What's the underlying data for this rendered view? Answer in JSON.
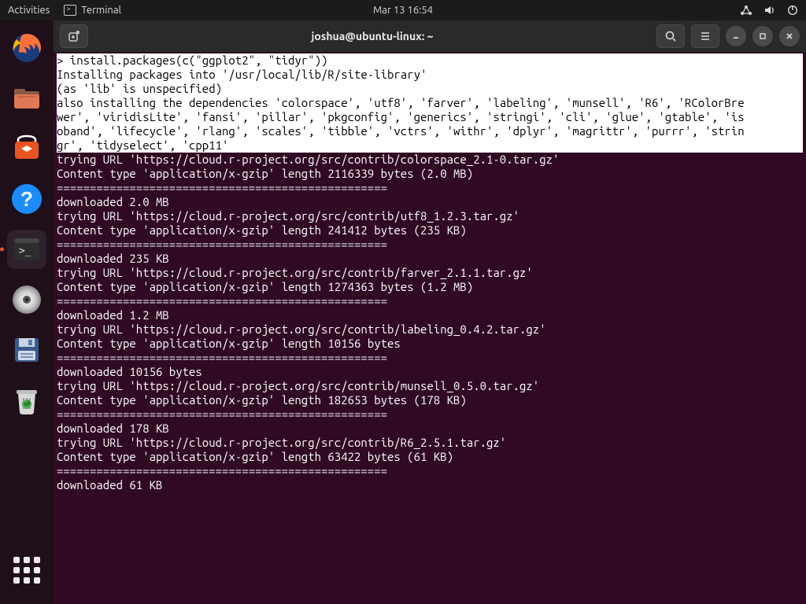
{
  "top_panel": {
    "activities": "Activities",
    "app_label": "Terminal",
    "clock": "Mar 13  16:54"
  },
  "window": {
    "title": "joshua@ubuntu-linux: ~"
  },
  "terminal": {
    "hl_lines": [
      "> install.packages(c(\"ggplot2\", \"tidyr\"))",
      "Installing packages into '/usr/local/lib/R/site-library'",
      "(as 'lib' is unspecified)",
      "also installing the dependencies 'colorspace', 'utf8', 'farver', 'labeling', 'munsell', 'R6', 'RColorBre",
      "wer', 'viridisLite', 'fansi', 'pillar', 'pkgconfig', 'generics', 'stringi', 'cli', 'glue', 'gtable', 'is",
      "oband', 'lifecycle', 'rlang', 'scales', 'tibble', 'vctrs', 'withr', 'dplyr', 'magrittr', 'purrr', 'strin",
      "gr', 'tidyselect', 'cpp11'"
    ],
    "body_lines": [
      "",
      "trying URL 'https://cloud.r-project.org/src/contrib/colorspace_2.1-0.tar.gz'",
      "Content type 'application/x-gzip' length 2116339 bytes (2.0 MB)",
      "==================================================",
      "downloaded 2.0 MB",
      "",
      "trying URL 'https://cloud.r-project.org/src/contrib/utf8_1.2.3.tar.gz'",
      "Content type 'application/x-gzip' length 241412 bytes (235 KB)",
      "==================================================",
      "downloaded 235 KB",
      "",
      "trying URL 'https://cloud.r-project.org/src/contrib/farver_2.1.1.tar.gz'",
      "Content type 'application/x-gzip' length 1274363 bytes (1.2 MB)",
      "==================================================",
      "downloaded 1.2 MB",
      "",
      "trying URL 'https://cloud.r-project.org/src/contrib/labeling_0.4.2.tar.gz'",
      "Content type 'application/x-gzip' length 10156 bytes",
      "==================================================",
      "downloaded 10156 bytes",
      "",
      "trying URL 'https://cloud.r-project.org/src/contrib/munsell_0.5.0.tar.gz'",
      "Content type 'application/x-gzip' length 182653 bytes (178 KB)",
      "==================================================",
      "downloaded 178 KB",
      "",
      "trying URL 'https://cloud.r-project.org/src/contrib/R6_2.5.1.tar.gz'",
      "Content type 'application/x-gzip' length 63422 bytes (61 KB)",
      "==================================================",
      "downloaded 61 KB"
    ]
  }
}
